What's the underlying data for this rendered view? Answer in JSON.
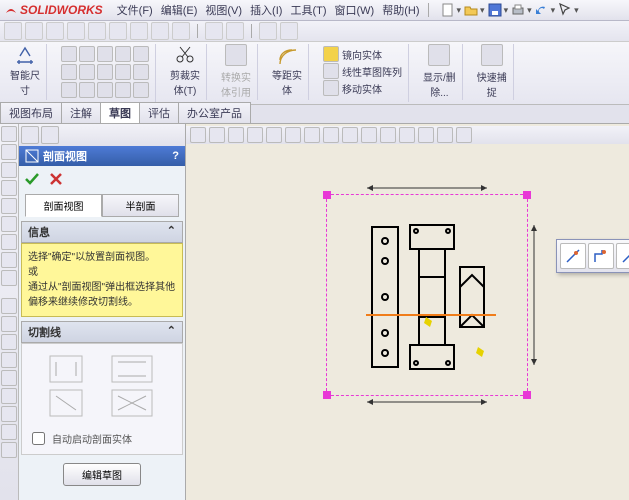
{
  "brand": "SOLIDWORKS",
  "menu": [
    "文件(F)",
    "编辑(E)",
    "视图(V)",
    "插入(I)",
    "工具(T)",
    "窗口(W)",
    "帮助(H)"
  ],
  "ribbon": {
    "smart_dim": "智能尺\n寸",
    "trim": "剪裁实\n体(T)",
    "convert": "转换实\n体引用",
    "offset": "等距实\n体",
    "mirror": "镜向实体",
    "linear": "线性草图阵列",
    "move": "移动实体",
    "showhide": "显示/删\n除...",
    "quick": "快速捕\n捉"
  },
  "tabs": [
    "视图布局",
    "注解",
    "草图",
    "评估",
    "办公室产品"
  ],
  "active_tab": 2,
  "panel": {
    "title": "剖面视图",
    "help": "?",
    "subtabs": [
      "剖面视图",
      "半剖面"
    ],
    "info_hdr": "信息",
    "info_body1": "选择\"确定\"以放置剖面视图。",
    "info_or": "或",
    "info_body2": "通过从\"剖面视图\"弹出框选择其他偏移来继续修改切割线。",
    "cut_hdr": "切割线",
    "auto_start": "自动启动剖面实体",
    "edit_sketch": "编辑草图"
  }
}
